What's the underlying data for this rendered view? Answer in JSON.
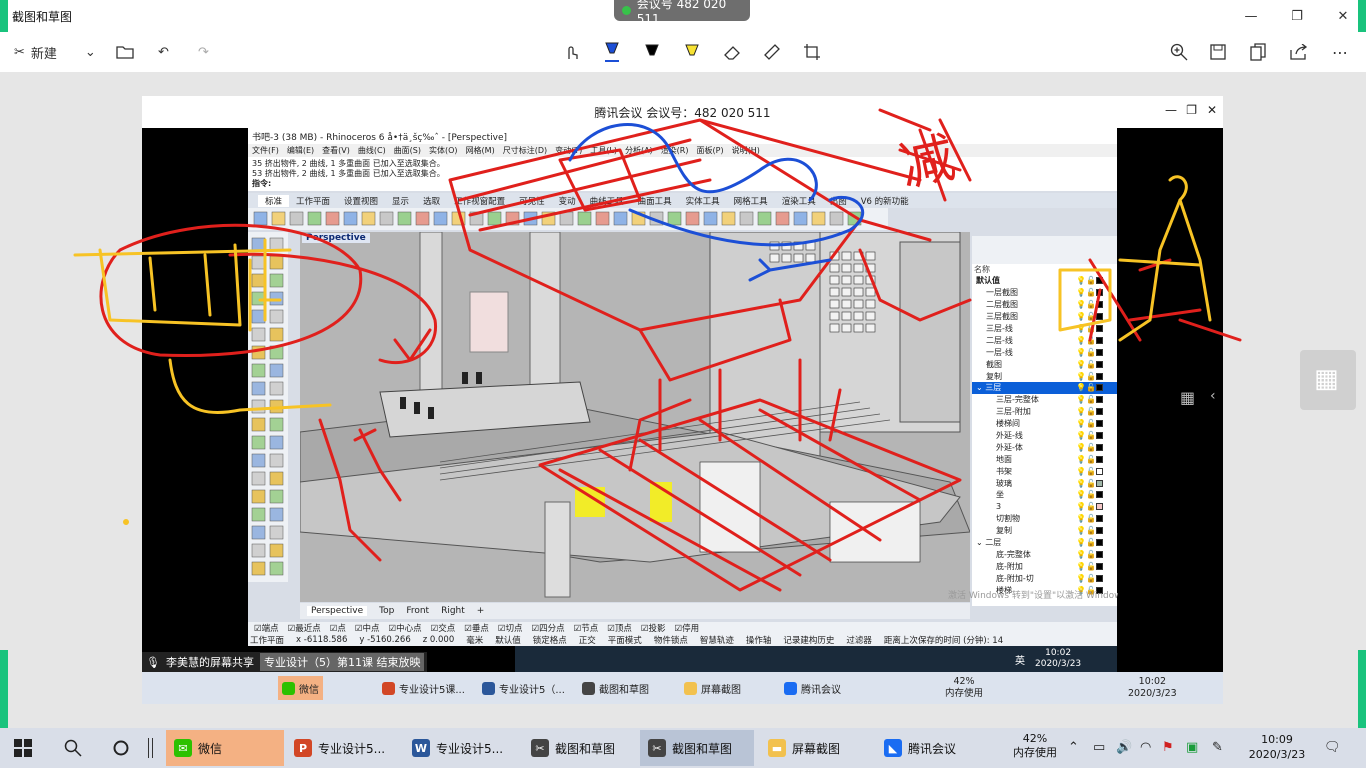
{
  "app": {
    "title": "截图和草图",
    "meeting_pill": "会议号 482 020 511",
    "new_label": "新建",
    "window_controls": [
      "—",
      "❐",
      "✕"
    ]
  },
  "toolbar_icons": [
    "touch-writing-icon",
    "ballpoint-pen-icon",
    "pencil-icon",
    "highlighter-icon",
    "eraser-icon",
    "ruler-icon",
    "crop-icon",
    "zoom-in-icon",
    "save-icon",
    "copy-icon",
    "share-icon",
    "more-icon"
  ],
  "tencent_meeting": {
    "title": "腾讯会议  会议号：482 020 511"
  },
  "rhino": {
    "title": "书吧-3 (38 MB) - Rhinoceros 6 å•†ä¸šç‰ˆ - [Perspective]",
    "menu": [
      "文件(F)",
      "编辑(E)",
      "查看(V)",
      "曲线(C)",
      "曲面(S)",
      "实体(O)",
      "网格(M)",
      "尺寸标注(D)",
      "变动(T)",
      "工具(L)",
      "分析(A)",
      "渲染(R)",
      "面板(P)",
      "说明(H)"
    ],
    "cmd_lines": [
      "35 挤出物件, 2 曲线, 1 多重曲面 已加入至选取集合。",
      "53 挤出物件, 2 曲线, 1 多重曲面 已加入至选取集合。",
      "指令:"
    ],
    "tabs": [
      "标准",
      "工作平面",
      "设置视图",
      "显示",
      "选取",
      "工作视窗配置",
      "可见性",
      "变动",
      "曲线工具",
      "曲面工具",
      "实体工具",
      "网格工具",
      "渲染工具",
      "出图",
      "V6 的新功能"
    ],
    "viewport_label": "Perspective",
    "viewport_tabs": [
      "Perspective",
      "Top",
      "Front",
      "Right"
    ],
    "snaps": [
      "端点",
      "最近点",
      "点",
      "中点",
      "中心点",
      "交点",
      "垂点",
      "切点",
      "四分点",
      "节点",
      "顶点",
      "投影",
      "停用"
    ],
    "status": [
      "工作平面",
      "x -6118.586",
      "y -5160.266",
      "z 0.000",
      "毫米",
      "默认值",
      "锁定格点",
      "正交",
      "平面模式",
      "物件锁点",
      "智慧轨迹",
      "操作轴",
      "记录建构历史",
      "过滤器",
      "距离上次保存的时间 (分钟): 14"
    ]
  },
  "layers": {
    "column_name": "名称",
    "rows": [
      {
        "name": "默认值",
        "indent": 0,
        "bold": true,
        "color": "#000000"
      },
      {
        "name": "一层截图",
        "indent": 1,
        "color": "#000000"
      },
      {
        "name": "二层截图",
        "indent": 1,
        "color": "#000000"
      },
      {
        "name": "三层截图",
        "indent": 1,
        "color": "#000000"
      },
      {
        "name": "三层-线",
        "indent": 1,
        "color": "#000000"
      },
      {
        "name": "二层-线",
        "indent": 1,
        "color": "#000000"
      },
      {
        "name": "一层-线",
        "indent": 1,
        "color": "#000000"
      },
      {
        "name": "截图",
        "indent": 1,
        "color": "#000000"
      },
      {
        "name": "复制",
        "indent": 1,
        "color": "#000000"
      },
      {
        "name": "三层",
        "indent": 0,
        "selected": true,
        "color": "#000000"
      },
      {
        "name": "三层-完整体",
        "indent": 2,
        "color": "#000000"
      },
      {
        "name": "三层-附加",
        "indent": 2,
        "color": "#000000"
      },
      {
        "name": "楼梯间",
        "indent": 2,
        "color": "#000000"
      },
      {
        "name": "外延-线",
        "indent": 2,
        "color": "#000000"
      },
      {
        "name": "外延-体",
        "indent": 2,
        "color": "#000000"
      },
      {
        "name": "地面",
        "indent": 2,
        "color": "#000000"
      },
      {
        "name": "书架",
        "indent": 2,
        "color": "#ffffff"
      },
      {
        "name": "玻璃",
        "indent": 2,
        "color": "#9fb6a8"
      },
      {
        "name": "坐",
        "indent": 2,
        "color": "#000000"
      },
      {
        "name": "3",
        "indent": 2,
        "color": "#f4c6c6"
      },
      {
        "name": "切割物",
        "indent": 2,
        "color": "#000000"
      },
      {
        "name": "复制",
        "indent": 2,
        "color": "#000000"
      },
      {
        "name": "二层",
        "indent": 0,
        "color": "#000000"
      },
      {
        "name": "底-完整体",
        "indent": 2,
        "color": "#000000"
      },
      {
        "name": "底-附加",
        "indent": 2,
        "color": "#000000"
      },
      {
        "name": "底-附加-切",
        "indent": 2,
        "color": "#000000"
      },
      {
        "name": "楼梯",
        "indent": 2,
        "color": "#000000"
      }
    ],
    "watermark": "激活 Windows  转到\"设置\"以激活 Windows。"
  },
  "share_banner": "李美慧的屏幕共享",
  "inner_taskbar": {
    "lecture": "专业设计（5）第11课 结束放映",
    "time": "10:02",
    "date": "2020/3/23",
    "items": [
      "微信",
      "专业设计5课...",
      "专业设计5（...",
      "截图和草图",
      "屏幕截图",
      "腾讯会议"
    ],
    "mem_pct": "42%",
    "mem_label": "内存使用",
    "ime": "英"
  },
  "taskbar": {
    "items": [
      {
        "label": "微信",
        "icon": "wechat-icon",
        "color": "#2dc100",
        "active": true
      },
      {
        "label": "专业设计5...",
        "icon": "powerpoint-icon",
        "color": "#d24726"
      },
      {
        "label": "专业设计5...",
        "icon": "word-icon",
        "color": "#2b579a"
      },
      {
        "label": "截图和草图",
        "icon": "snip-sketch-icon",
        "color": "#444444"
      },
      {
        "label": "截图和草图",
        "icon": "snip-sketch-icon",
        "color": "#444444",
        "active": true
      },
      {
        "label": "屏幕截图",
        "icon": "folder-icon",
        "color": "#f2c14e"
      },
      {
        "label": "腾讯会议",
        "icon": "tencent-meeting-icon",
        "color": "#1a6cf2"
      }
    ],
    "mem_pct": "42%",
    "mem_label": "内存使用",
    "time": "10:09",
    "date": "2020/3/23"
  },
  "annotations": {
    "handwritten_char": "减",
    "colors": {
      "red": "#e0201c",
      "yellow": "#f7c325",
      "blue": "#1c4fd6"
    }
  }
}
